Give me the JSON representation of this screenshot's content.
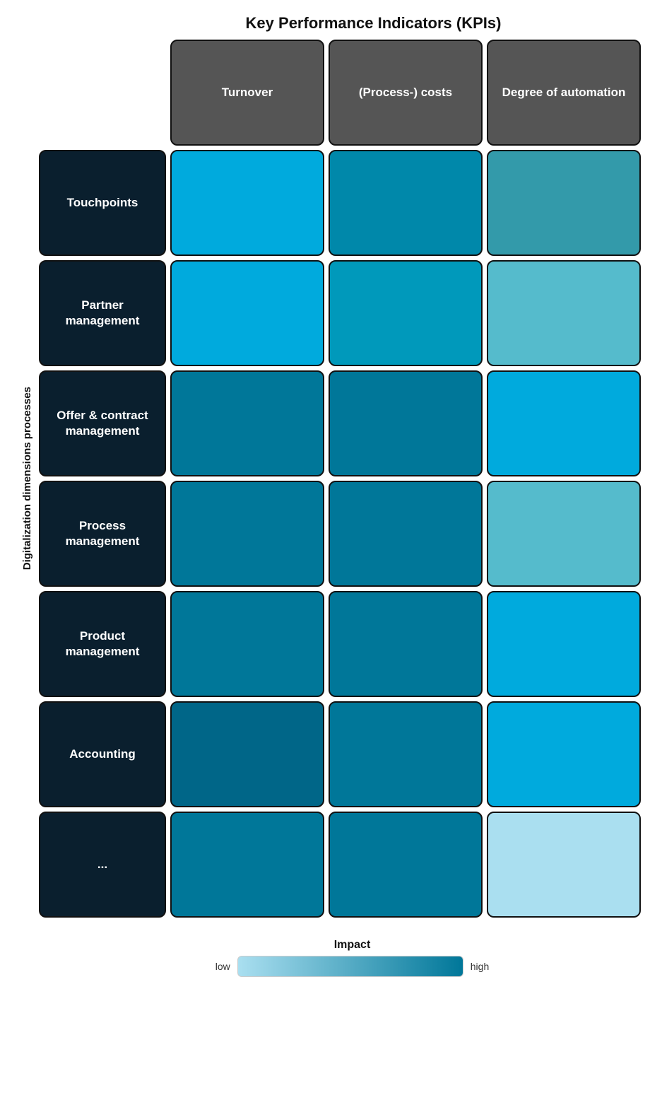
{
  "title": "Key Performance Indicators (KPIs)",
  "y_axis_label": "Digitalization dimensions processes",
  "headers": {
    "empty": "",
    "col1": "Turnover",
    "col2": "(Process-) costs",
    "col3": "Degree of automation"
  },
  "rows": [
    {
      "label": "Touchpoints",
      "cells": [
        "bright-blue",
        "medium-blue",
        "light-teal"
      ]
    },
    {
      "label": "Partner management",
      "cells": [
        "bright-blue",
        "medium2",
        "lighter-blue"
      ]
    },
    {
      "label": "Offer & contract management",
      "cells": [
        "teal",
        "teal",
        "bright-blue"
      ]
    },
    {
      "label": "Process management",
      "cells": [
        "teal",
        "teal",
        "lighter-blue"
      ]
    },
    {
      "label": "Product management",
      "cells": [
        "teal",
        "teal",
        "bright-blue"
      ]
    },
    {
      "label": "Accounting",
      "cells": [
        "dark-teal",
        "teal",
        "bright-blue"
      ]
    },
    {
      "label": "...",
      "cells": [
        "teal",
        "teal",
        "pale-blue"
      ]
    }
  ],
  "legend": {
    "title": "Impact",
    "low_label": "low",
    "high_label": "high"
  }
}
